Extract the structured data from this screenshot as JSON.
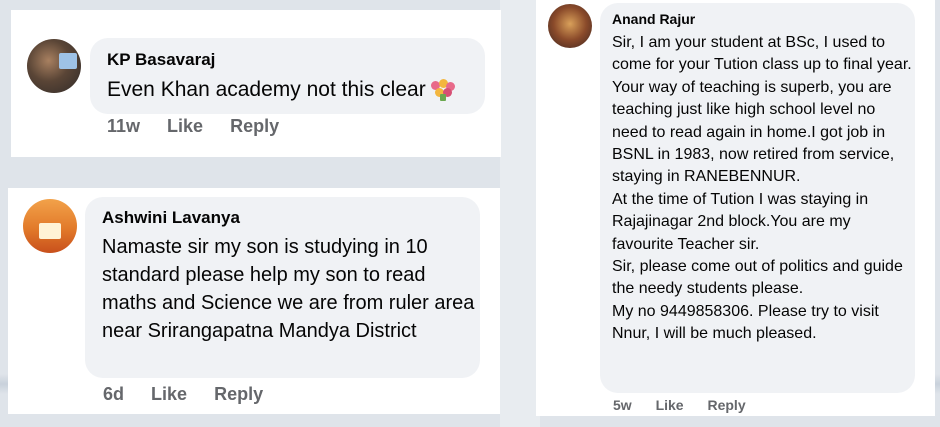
{
  "comments": [
    {
      "author": "KP Basavaraj",
      "text": "Even Khan academy not this clear",
      "emoji": "bouquet",
      "time": "11w",
      "like_label": "Like",
      "reply_label": "Reply"
    },
    {
      "author": "Ashwini Lavanya",
      "text": "Namaste sir my son is studying in 10 standard please help my son to read maths and Science we are from ruler area near Srirangapatna Mandya District",
      "time": "6d",
      "like_label": "Like",
      "reply_label": "Reply"
    },
    {
      "author": "Anand Rajur",
      "text": "Sir, I am your student at BSc, I used to come for your Tution class up to final year.\nYour way of teaching is superb, you are teaching just like high school level no need to read again in home.I got job in BSNL in 1983, now retired from service, staying in RANEBENNUR.\nAt the time of Tution I was staying in Rajajinagar 2nd block.You are my favourite Teacher sir.\nSir, please come out of politics and guide the needy students please.\nMy no 9449858306. Please try to visit Nnur, I will be much pleased.",
      "time": "5w",
      "like_label": "Like",
      "reply_label": "Reply"
    }
  ]
}
